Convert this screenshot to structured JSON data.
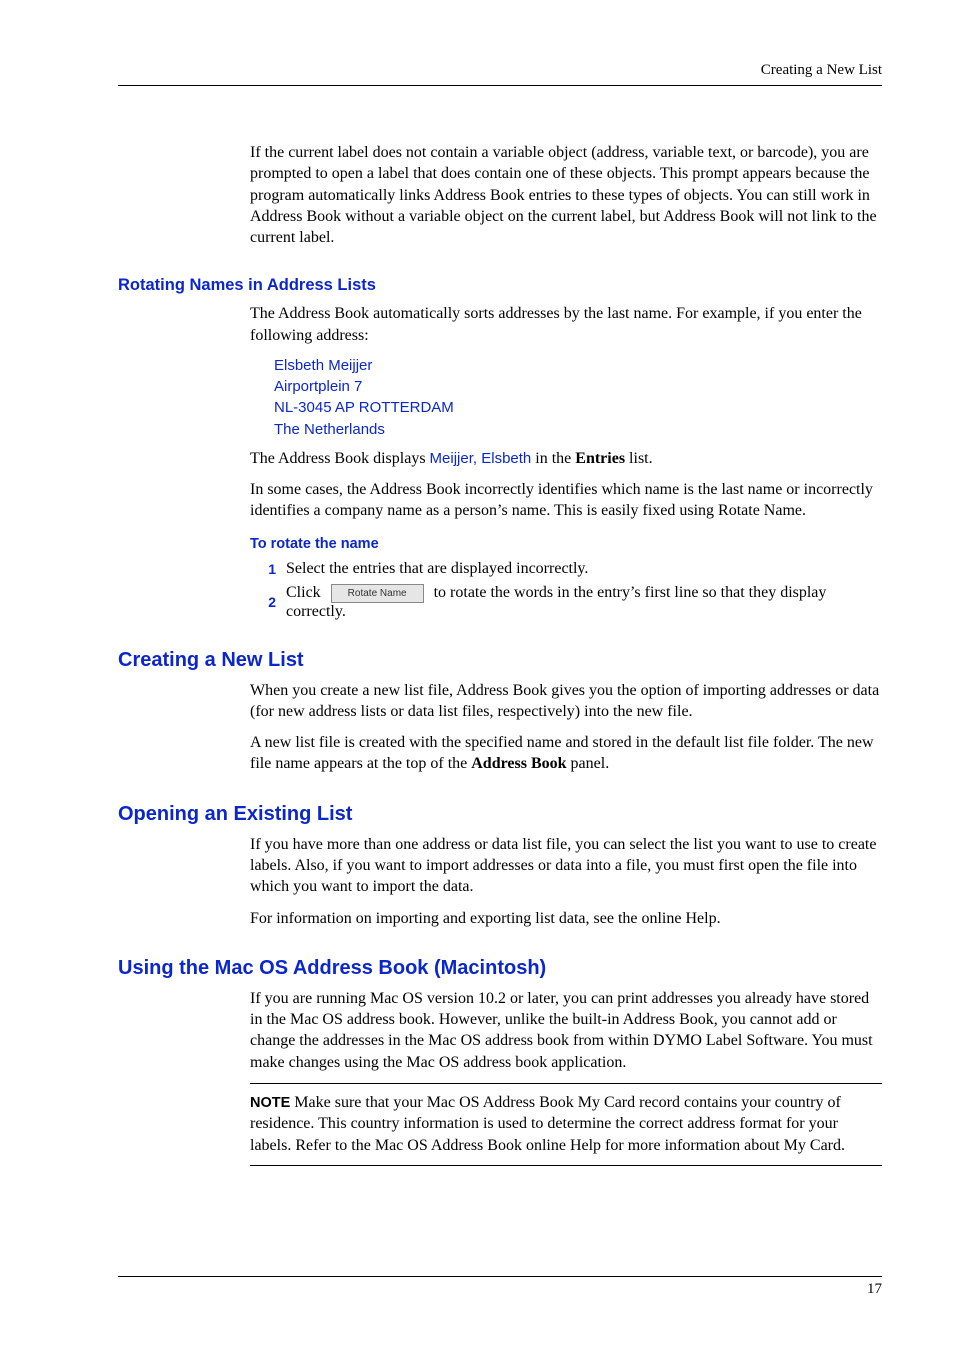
{
  "header": {
    "right": "Creating a New List"
  },
  "intro": {
    "p1": "If the current label does not contain a variable object (address, variable text, or barcode), you are prompted to open a label that does contain one of these objects. This prompt appears because the program automatically links Address Book entries to these types of objects. You can still work in Address Book without a variable object on the current label, but Address Book will not link to the current label."
  },
  "rotating": {
    "heading": "Rotating Names in Address Lists",
    "p1": "The Address Book automatically sorts addresses by the last name. For example, if you enter the following address:",
    "address": {
      "l1": "Elsbeth Meijjer",
      "l2": "Airportplein 7",
      "l3": "NL-3045 AP ROTTERDAM",
      "l4": "The Netherlands"
    },
    "p2_a": "The Address Book displays ",
    "p2_inline": "Meijjer, Elsbeth",
    "p2_b": " in the ",
    "p2_bold": "Entries",
    "p2_c": " list.",
    "p3": "In some cases, the Address Book incorrectly identifies which name is the last name or incorrectly identifies a company name as a person’s name. This is easily fixed using Rotate Name.",
    "proc_title": "To rotate the name",
    "steps": {
      "n1": "1",
      "s1": "Select the entries that are displayed incorrectly.",
      "n2": "2",
      "s2a": "Click ",
      "btn": "Rotate Name",
      "s2b": " to rotate the words in the entry’s first line so that they display correctly."
    }
  },
  "create": {
    "heading": "Creating a New List",
    "p1": "When you create a new list file, Address Book gives you the option of importing addresses or data (for new address lists or data list files, respectively) into the new file.",
    "p2a": "A new list file is created with the specified name and stored in the default list file folder. The new file name appears at the top of the ",
    "p2bold": "Address Book",
    "p2b": " panel."
  },
  "open": {
    "heading": "Opening an Existing List",
    "p1": "If you have more than one address or data list file, you can select the list you want to use to create labels. Also, if you want to import addresses or data into a file, you must first open the file into which you want to import the data.",
    "p2": "For information on importing and exporting list data, see the online Help."
  },
  "macos": {
    "heading": "Using the Mac OS Address Book (Macintosh)",
    "p1": "If you are running Mac OS version 10.2 or later, you can print addresses you already have stored in the Mac OS address book. However, unlike the built-in Address Book, you cannot add or change the addresses in the Mac OS address book from within DYMO Label Software. You must make changes using the Mac OS address book application.",
    "note_label": "NOTE",
    "note_body": "  Make sure that your Mac OS Address Book My Card record contains your country of residence. This country information is used to determine the correct address format for your labels. Refer to the Mac OS Address Book online Help for more information about My Card."
  },
  "footer": {
    "page": "17"
  }
}
